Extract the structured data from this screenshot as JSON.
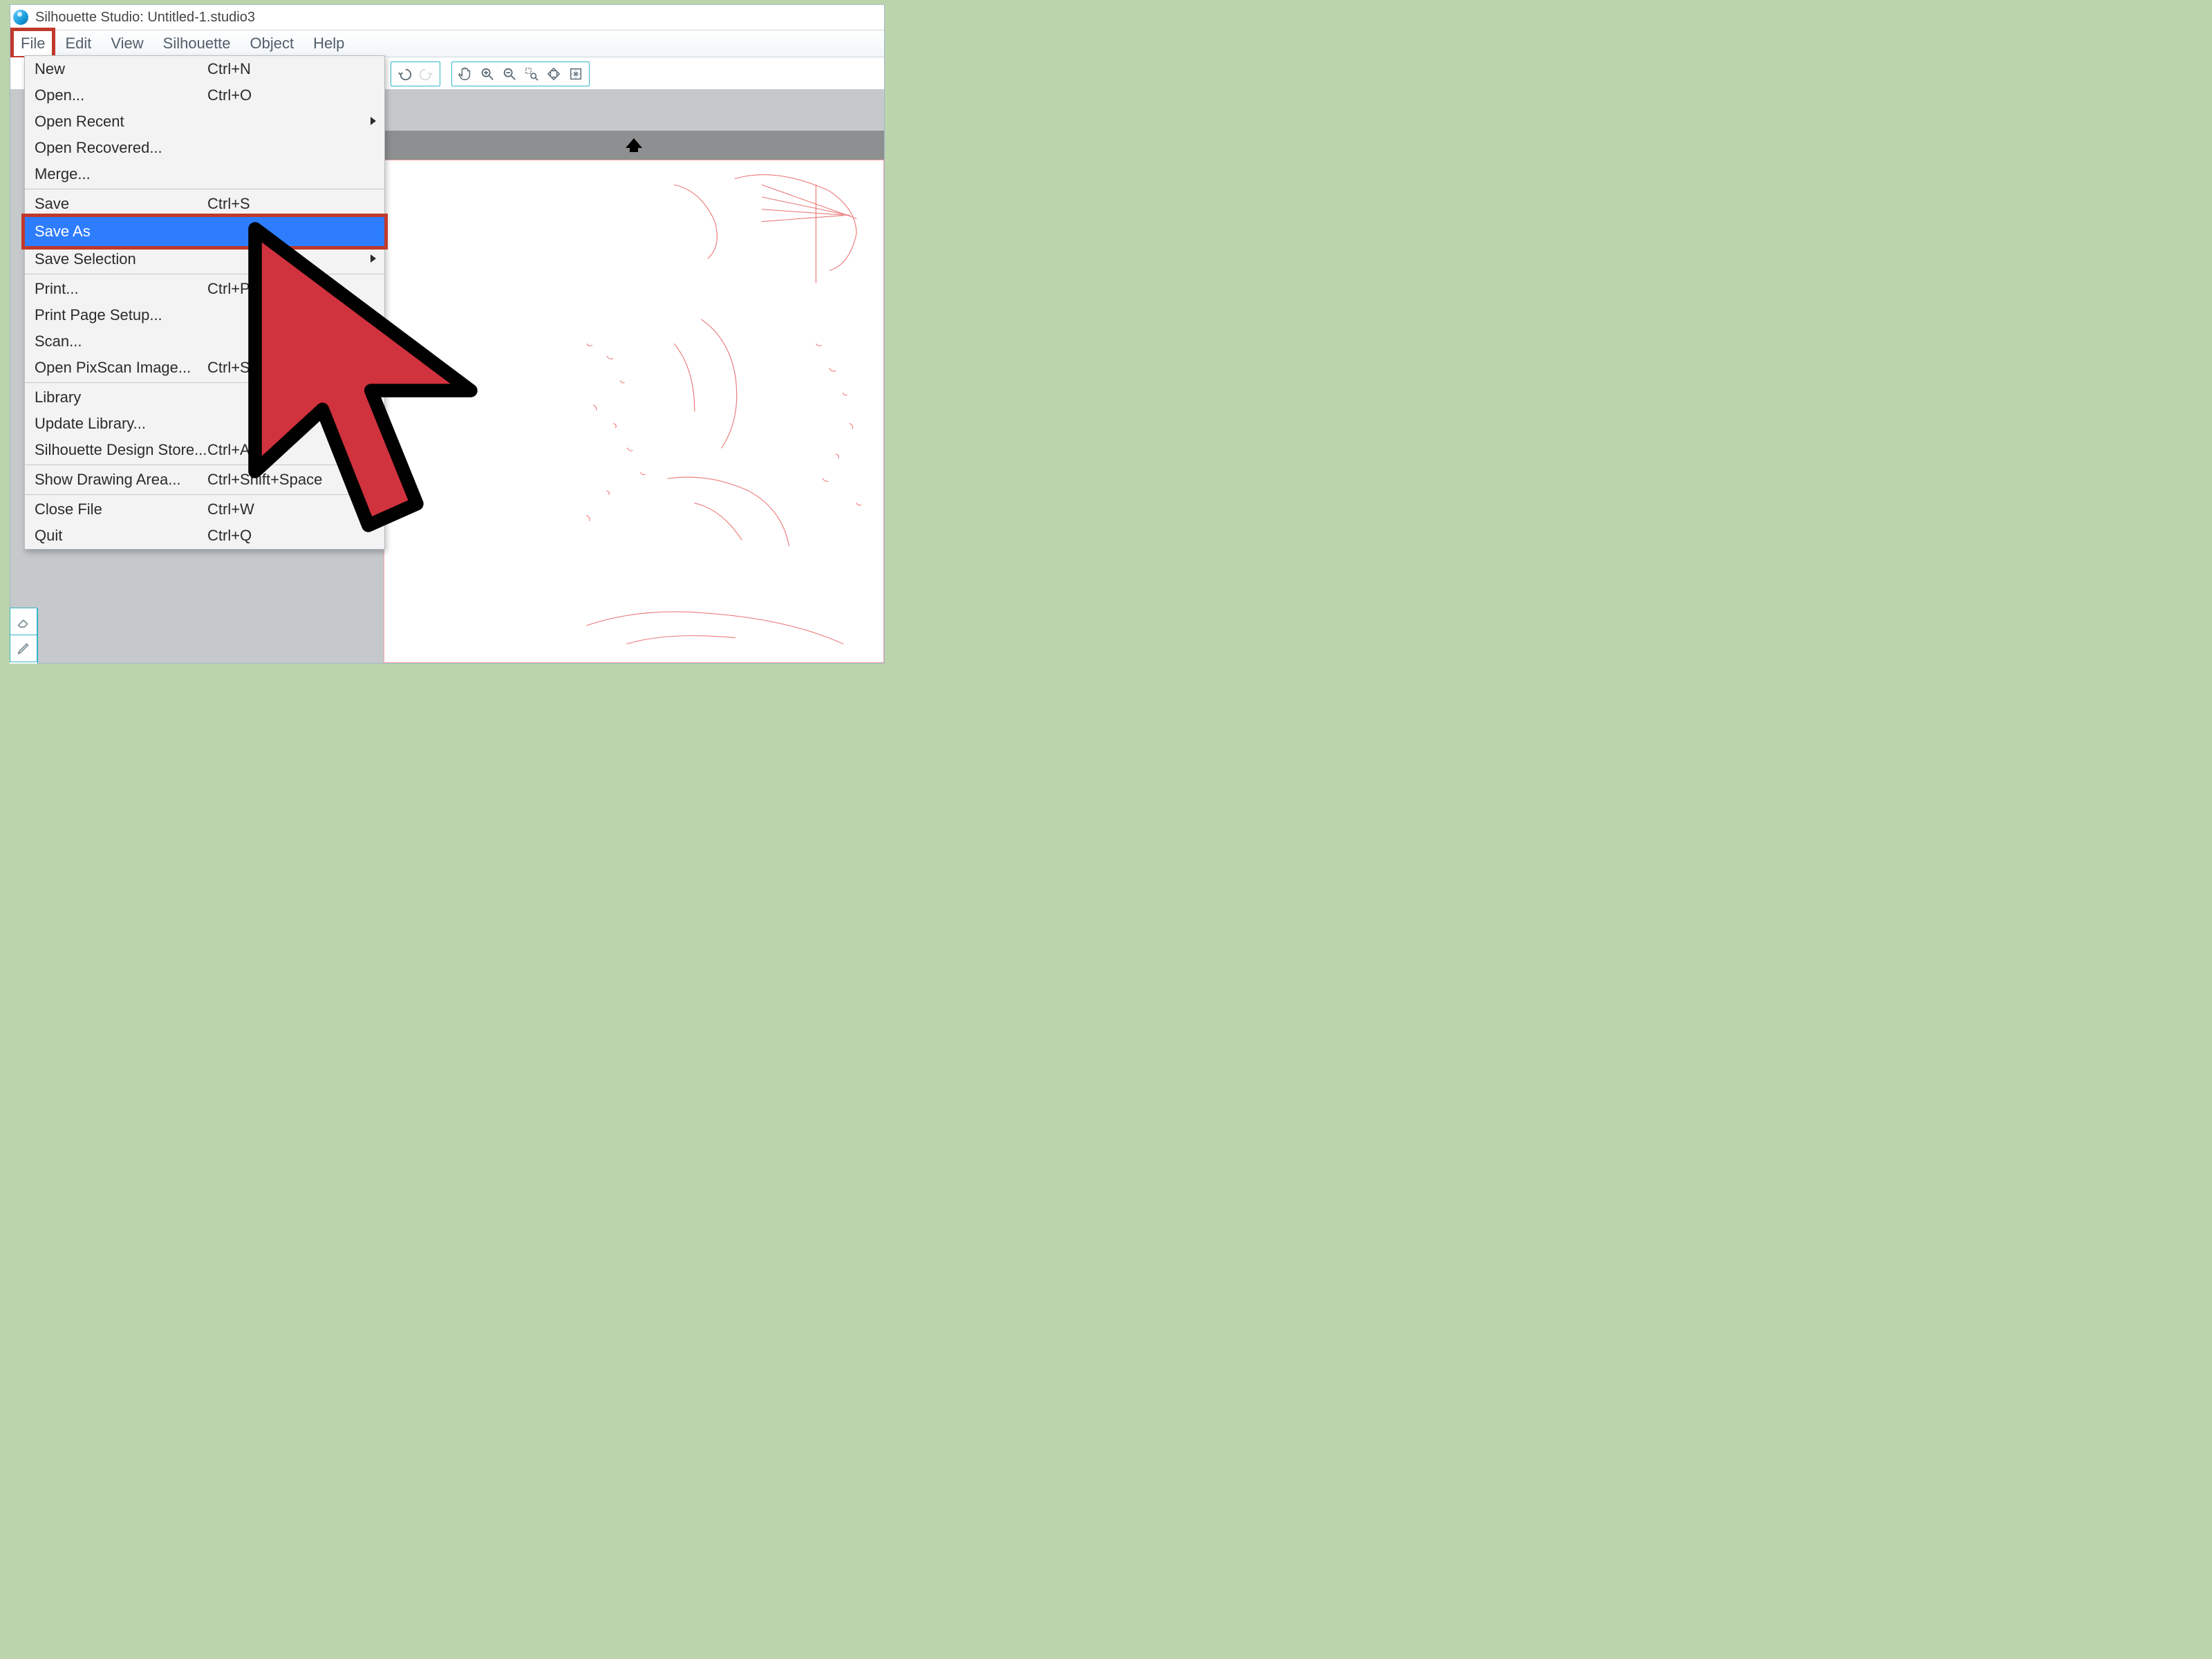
{
  "title": "Silhouette Studio: Untitled-1.studio3",
  "menubar": [
    "File",
    "Edit",
    "View",
    "Silhouette",
    "Object",
    "Help"
  ],
  "file_menu": {
    "groups": [
      [
        {
          "label": "New",
          "shortcut": "Ctrl+N"
        },
        {
          "label": "Open...",
          "shortcut": "Ctrl+O"
        },
        {
          "label": "Open Recent",
          "submenu": true
        },
        {
          "label": "Open Recovered..."
        },
        {
          "label": "Merge..."
        }
      ],
      [
        {
          "label": "Save",
          "shortcut": "Ctrl+S"
        },
        {
          "label": "Save As",
          "submenu": true,
          "highlight": true
        },
        {
          "label": "Save Selection",
          "submenu": true
        }
      ],
      [
        {
          "label": "Print...",
          "shortcut": "Ctrl+P"
        },
        {
          "label": "Print Page Setup..."
        },
        {
          "label": "Scan..."
        },
        {
          "label": "Open PixScan Image...",
          "shortcut": "Ctrl+Shift+O"
        }
      ],
      [
        {
          "label": "Library"
        },
        {
          "label": "Update Library..."
        },
        {
          "label": "Silhouette Design Store...",
          "shortcut": "Ctrl+Alt+S"
        }
      ],
      [
        {
          "label": "Show Drawing Area...",
          "shortcut": "Ctrl+Shift+Space"
        }
      ],
      [
        {
          "label": "Close File",
          "shortcut": "Ctrl+W"
        },
        {
          "label": "Quit",
          "shortcut": "Ctrl+Q"
        }
      ]
    ]
  },
  "toolbar": {
    "undo": "undo-icon",
    "redo": "redo-icon",
    "pan": "pan-icon",
    "zoom_in": "zoom-in-icon",
    "zoom_out": "zoom-out-icon",
    "zoom_sel": "zoom-selection-icon",
    "zoom_fit": "zoom-fit-icon",
    "zoom_center": "zoom-center-icon"
  },
  "tool_strip": {
    "eraser": "eraser-icon",
    "pencil": "pencil-icon"
  }
}
